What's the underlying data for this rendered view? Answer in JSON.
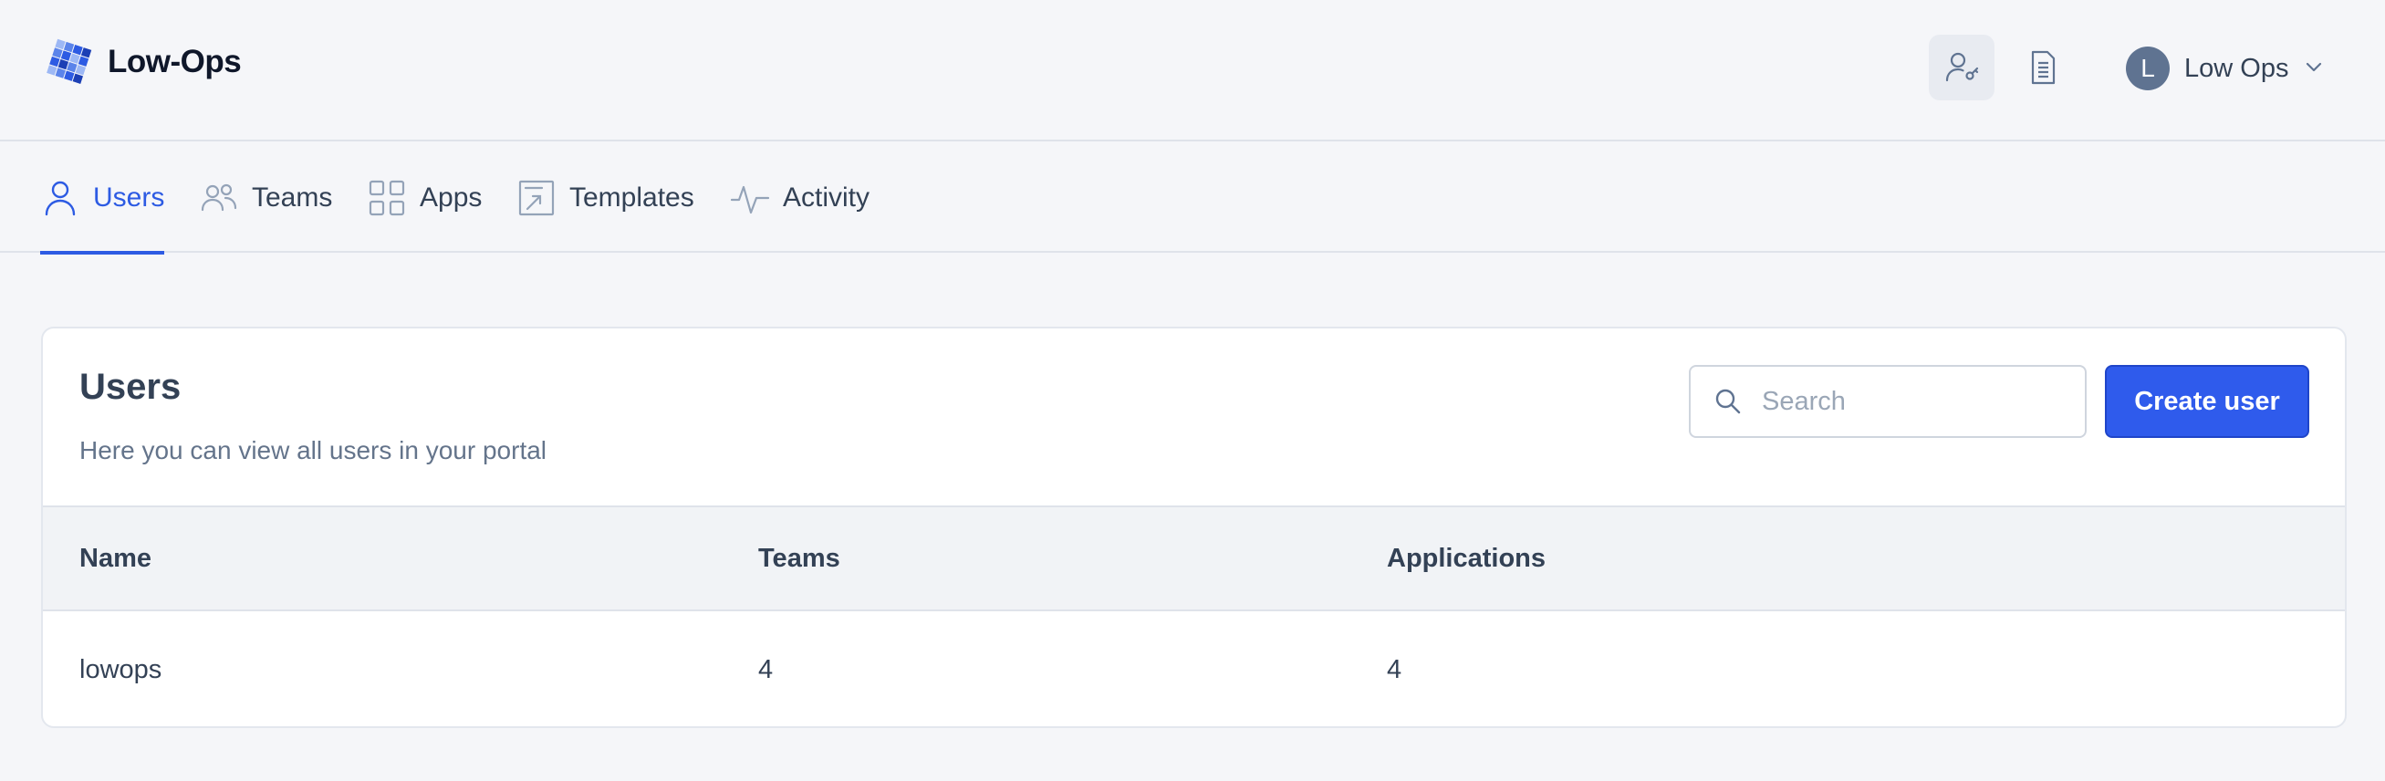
{
  "brand": {
    "name": "Low-Ops",
    "logo_color": "#2d5be3"
  },
  "header": {
    "user": {
      "initial": "L",
      "name": "Low Ops"
    }
  },
  "tabs": [
    {
      "label": "Users",
      "icon": "user-icon",
      "active": true
    },
    {
      "label": "Teams",
      "icon": "users-icon",
      "active": false
    },
    {
      "label": "Apps",
      "icon": "grid-icon",
      "active": false
    },
    {
      "label": "Templates",
      "icon": "template-icon",
      "active": false
    },
    {
      "label": "Activity",
      "icon": "activity-icon",
      "active": false
    }
  ],
  "card": {
    "title": "Users",
    "subtitle": "Here you can view all users in your portal",
    "search_placeholder": "Search",
    "create_label": "Create user"
  },
  "table": {
    "columns": [
      "Name",
      "Teams",
      "Applications"
    ],
    "rows": [
      [
        "lowops",
        "4",
        "4"
      ]
    ]
  },
  "colors": {
    "accent": "#2d5be3",
    "button": "#2f5bec"
  }
}
